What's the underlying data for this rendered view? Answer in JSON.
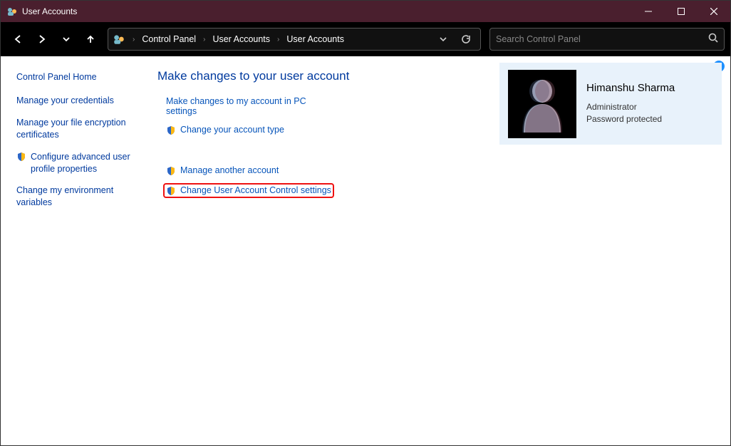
{
  "titlebar": {
    "title": "User Accounts"
  },
  "breadcrumb": {
    "c1": "Control Panel",
    "c2": "User Accounts",
    "c3": "User Accounts"
  },
  "search": {
    "placeholder": "Search Control Panel"
  },
  "sidebar": {
    "home": "Control Panel Home",
    "links": [
      "Manage your credentials",
      "Manage your file encryption certificates",
      "Configure advanced user profile properties",
      "Change my environment variables"
    ]
  },
  "main": {
    "heading": "Make changes to your user account",
    "actions": {
      "a1": "Make changes to my account in PC settings",
      "a2": "Change your account type",
      "a3": "Manage another account",
      "a4": "Change User Account Control settings"
    }
  },
  "user": {
    "name": "Himanshu Sharma",
    "role": "Administrator",
    "pw": "Password protected"
  },
  "help": "?"
}
